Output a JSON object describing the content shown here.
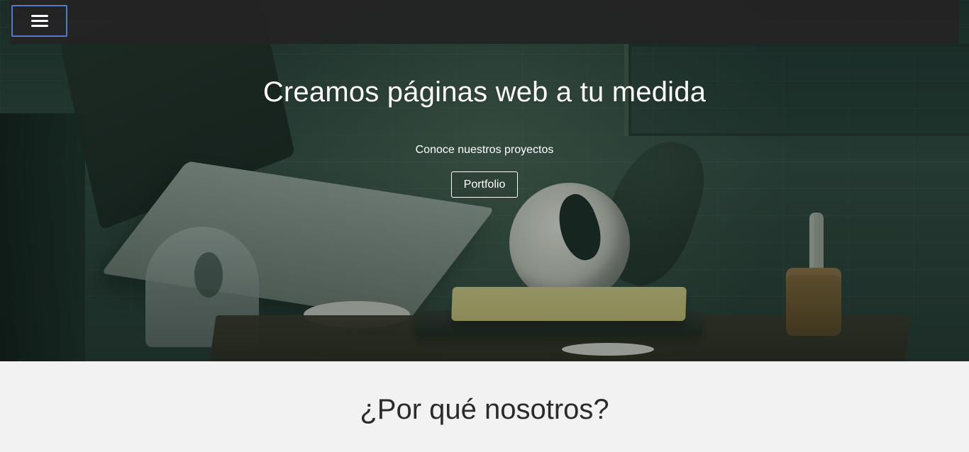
{
  "hero": {
    "title": "Creamos páginas web a tu medida",
    "subtitle": "Conoce nuestros proyectos",
    "button_label": "Portfolio"
  },
  "navbar": {
    "menu_icon": "hamburger-menu-icon",
    "background_color": "#232323",
    "button_border_color": "#5777c8"
  },
  "section": {
    "heading": "¿Por qué nosotros?"
  },
  "theme": {
    "page_background": "#f2f2f2",
    "hero_text_color": "#ffffff",
    "heading_color": "#2b2b2b"
  }
}
